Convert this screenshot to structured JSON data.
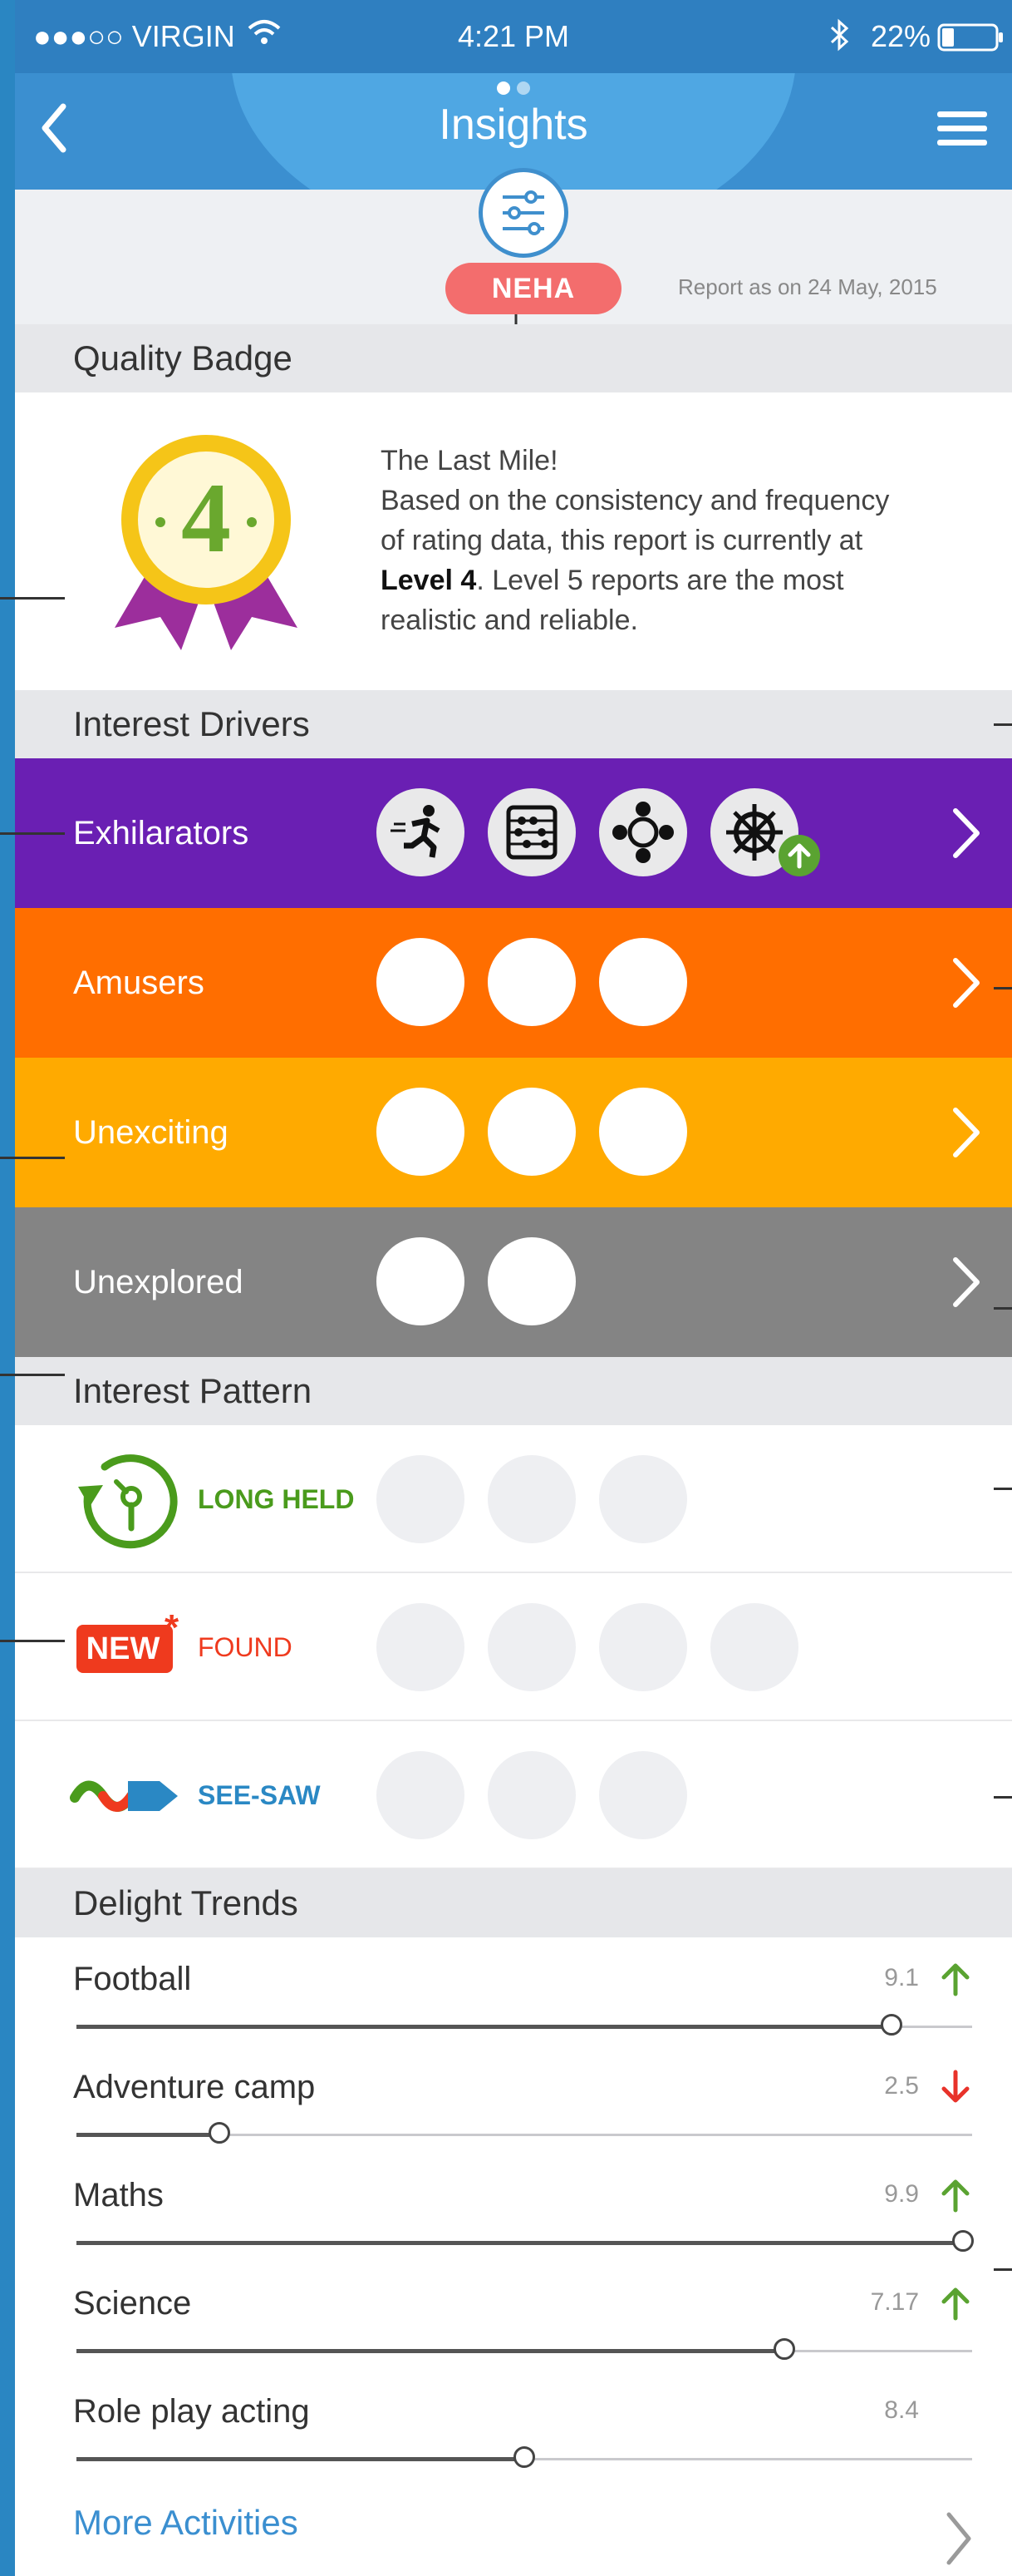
{
  "status_bar": {
    "carrier": "●●●○○ VIRGIN",
    "time": "4:21 PM",
    "battery": "22%"
  },
  "nav": {
    "title": "Insights",
    "back_icon": "chevron-left-icon",
    "menu_icon": "hamburger-menu-icon"
  },
  "profile": {
    "name": "NEHA",
    "report_date": "Report as on 24 May, 2015"
  },
  "quality_badge": {
    "header": "Quality Badge",
    "level_number": "4",
    "line1": "The Last Mile!",
    "line2": "Based on the consistency and frequency",
    "line3": "of rating data, this report is currently at",
    "level_bold": "Level 4",
    "line4_rest": ". Level 5 reports are the most",
    "line5": "realistic and reliable."
  },
  "interest_drivers": {
    "header": "Interest Drivers",
    "rows": [
      {
        "label": "Exhilarators",
        "color": "#6a1fb3",
        "icons": [
          "running-icon",
          "abacus-icon",
          "network-icon",
          "ship-wheel-icon"
        ]
      },
      {
        "label": "Amusers",
        "color": "#ff6e00",
        "count": 3
      },
      {
        "label": "Unexciting",
        "color": "#ffaa00",
        "count": 3
      },
      {
        "label": "Unexplored",
        "color": "#848484",
        "count": 2
      }
    ]
  },
  "interest_pattern": {
    "header": "Interest Pattern",
    "rows": [
      {
        "label": "LONG HELD",
        "color": "#4a9b1c",
        "count": 3
      },
      {
        "label": "FOUND",
        "badge": "NEW",
        "color": "#ef3a1e",
        "count": 4
      },
      {
        "label": "SEE-SAW",
        "color": "#2a88c4",
        "count": 3
      }
    ]
  },
  "delight_trends": {
    "header": "Delight Trends",
    "items": [
      {
        "name": "Football",
        "value": "9.1",
        "trend": "up",
        "level": 0.91
      },
      {
        "name": "Adventure camp",
        "value": "2.5",
        "trend": "down",
        "level": 0.16
      },
      {
        "name": "Maths",
        "value": "9.9",
        "trend": "up",
        "level": 0.99
      },
      {
        "name": "Science",
        "value": "7.17",
        "trend": "up",
        "level": 0.79
      },
      {
        "name": "Role play acting",
        "value": "8.4",
        "trend": "none",
        "level": 0.5
      }
    ],
    "more_label": "More  Activities"
  },
  "colors": {
    "accent": "#3b8fd0",
    "up": "#5aa331",
    "down": "#e8322a"
  }
}
